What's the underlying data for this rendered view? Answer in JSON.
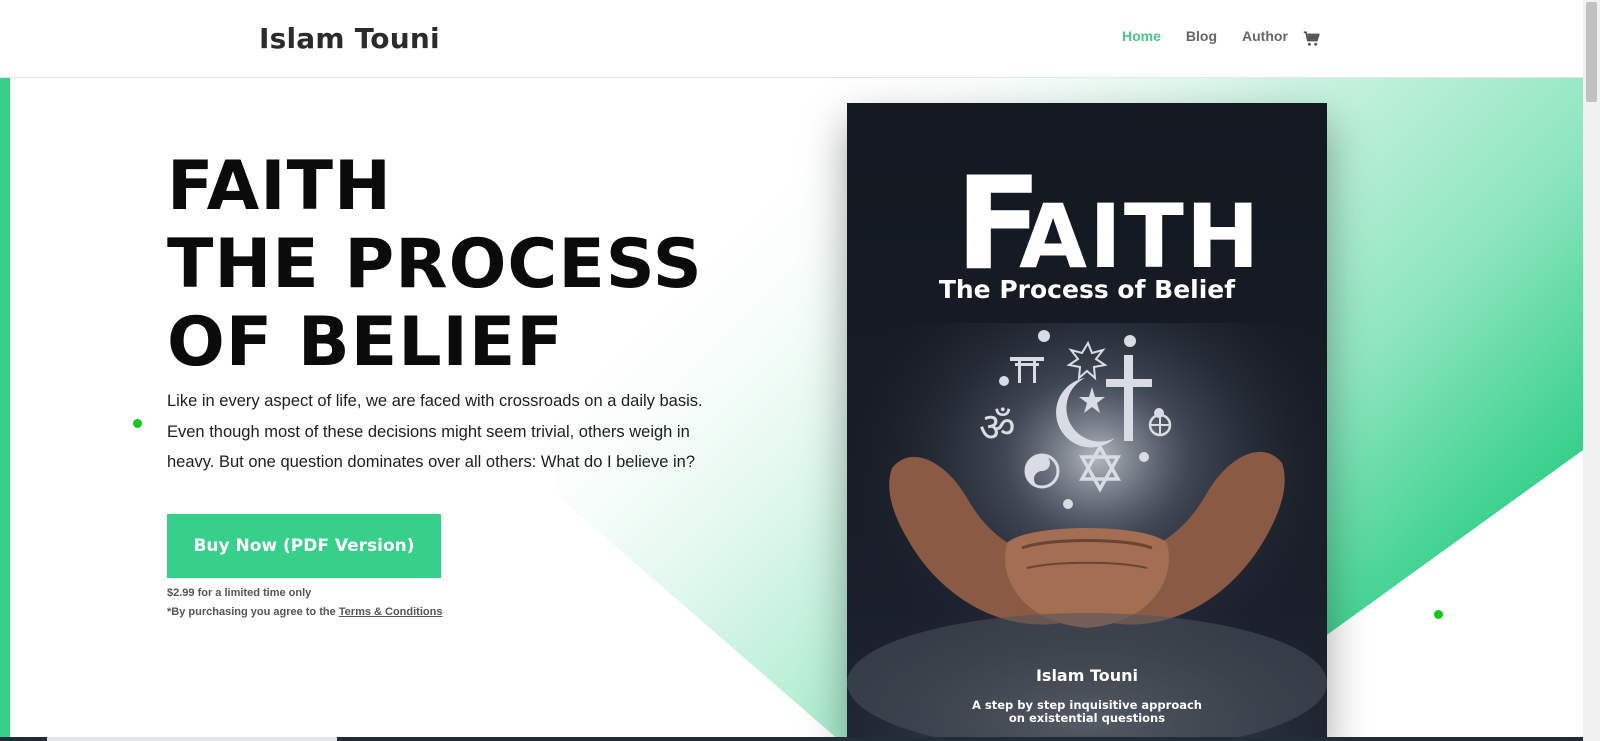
{
  "site": {
    "logo": "Islam Touni"
  },
  "nav": {
    "items": [
      "Home",
      "Blog",
      "Author"
    ],
    "active": "Home",
    "cart_icon": "shopping-cart-icon"
  },
  "hero": {
    "title_lines": [
      "FAITH",
      "THE PROCESS",
      "OF BELIEF"
    ],
    "description": "Like in every aspect of life, we are faced with crossroads on a daily basis. Even though most of these decisions might seem trivial, others weigh in heavy. But one question dominates over all others: What do I believe in?",
    "buy_button": "Buy Now (PDF Version)",
    "price_note": "$2.99 for a limited time only",
    "terms_prefix": "*By purchasing you agree to the ",
    "terms_link": "Terms & Conditions"
  },
  "book": {
    "title_initial": "F",
    "title_rest": "AITH",
    "subtitle": "The Process of Belief",
    "author": "Islam Touni",
    "tagline_lines": [
      "A step by step inquisitive approach",
      "on existential questions"
    ]
  },
  "colors": {
    "accent": "#36d08a",
    "nav_active": "#4fc386",
    "dot": "#16c916",
    "cover_bg": "#131821"
  }
}
